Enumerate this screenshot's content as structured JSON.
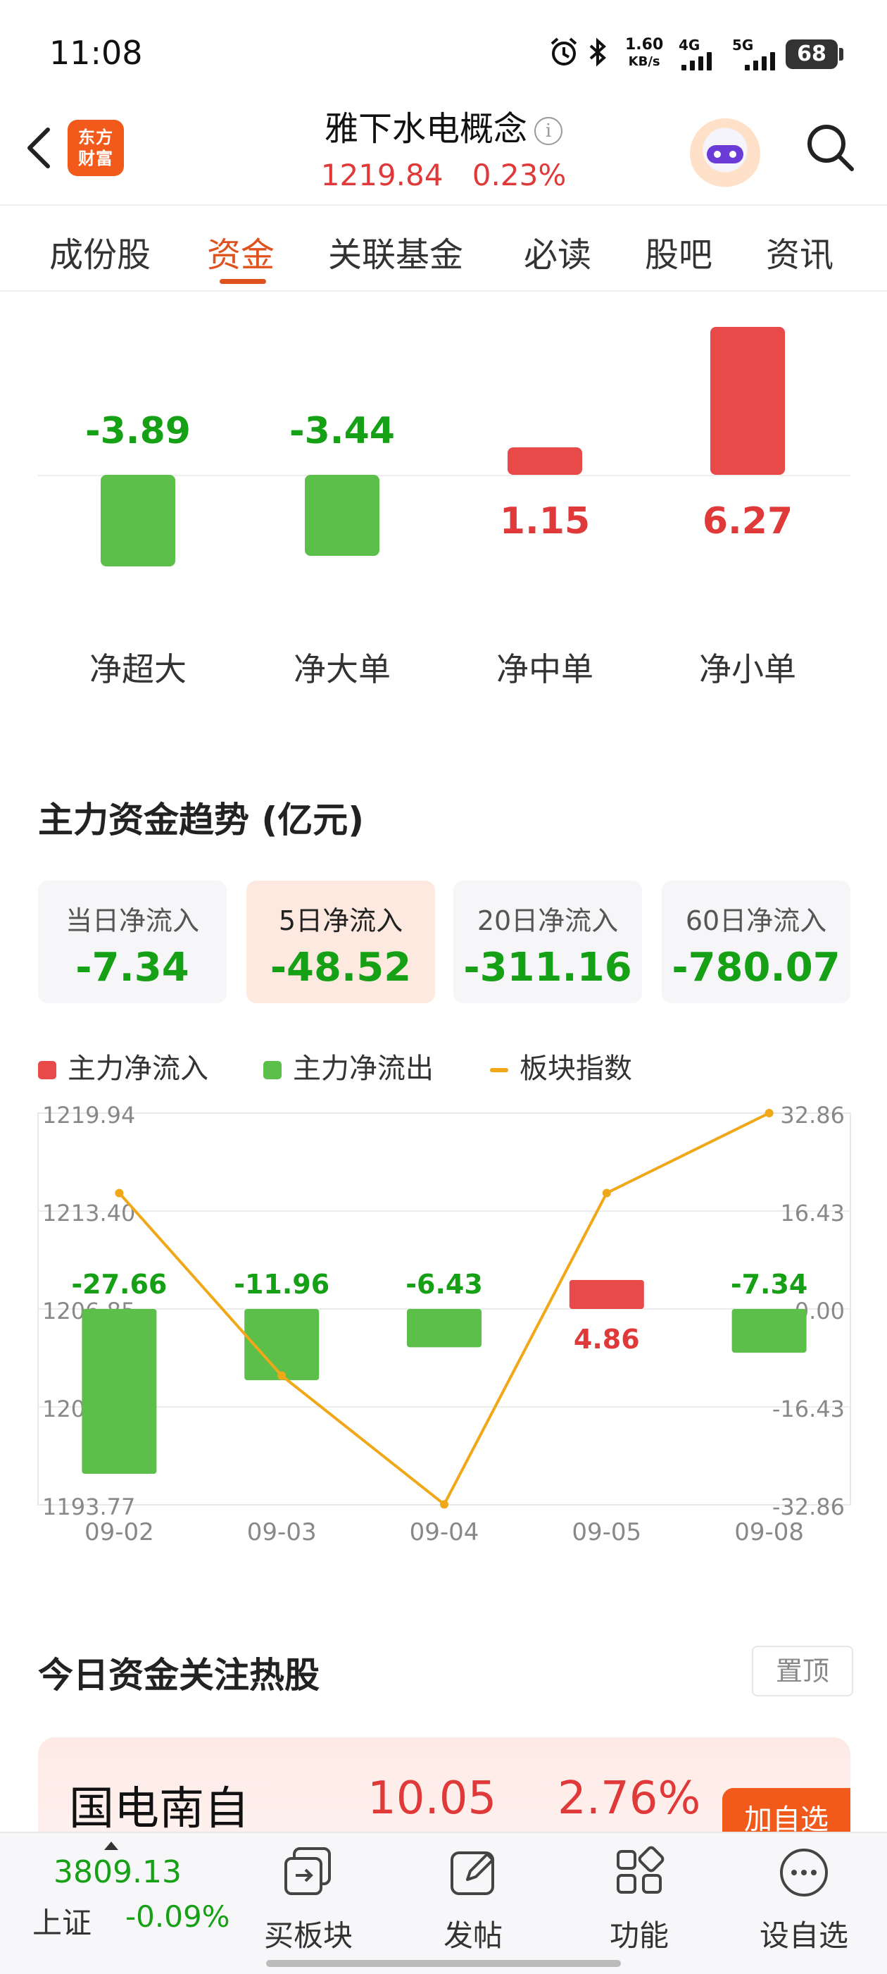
{
  "status_bar": {
    "time": "11:08",
    "net_speed_value": "1.60",
    "net_speed_unit": "KB/s",
    "signal_1_label": "4G",
    "signal_2_label": "5G",
    "battery": "68"
  },
  "header": {
    "logo_text_line1": "东方",
    "logo_text_line2": "财富",
    "title": "雅下水电概念",
    "info_icon": "i",
    "index_value": "1219.84",
    "index_change": "0.23%"
  },
  "tabs": [
    {
      "label": "成份股"
    },
    {
      "label": "资金"
    },
    {
      "label": "关联基金"
    },
    {
      "label": "必读"
    },
    {
      "label": "股吧"
    },
    {
      "label": "资讯"
    }
  ],
  "breakdown": {
    "colors": {
      "positive": "#e84a4a",
      "negative": "#5cbf4a"
    },
    "items": [
      {
        "label": "净超大",
        "value_text": "-3.89",
        "value": -3.89
      },
      {
        "label": "净大单",
        "value_text": "-3.44",
        "value": -3.44
      },
      {
        "label": "净中单",
        "value_text": "1.15",
        "value": 1.15
      },
      {
        "label": "净小单",
        "value_text": "6.27",
        "value": 6.27
      }
    ]
  },
  "trend_section": {
    "title": "主力资金趋势 (亿元)",
    "cards": [
      {
        "label": "当日净流入",
        "value": "-7.34"
      },
      {
        "label": "5日净流入",
        "value": "-48.52"
      },
      {
        "label": "20日净流入",
        "value": "-311.16"
      },
      {
        "label": "60日净流入",
        "value": "-780.07"
      }
    ],
    "legend": [
      {
        "label": "主力净流入",
        "color": "#e84a4a"
      },
      {
        "label": "主力净流出",
        "color": "#5cbf4a"
      },
      {
        "label": "板块指数",
        "color": "#f0a818"
      }
    ]
  },
  "chart_data": {
    "type": "bar",
    "categories": [
      "09-02",
      "09-03",
      "09-04",
      "09-05",
      "09-08"
    ],
    "series": [
      {
        "name": "主力净流入",
        "values": [
          -27.66,
          -11.96,
          -6.43,
          4.86,
          -7.34
        ],
        "labels": [
          "-27.66",
          "-11.96",
          "-6.43",
          "4.86",
          "-7.34"
        ]
      },
      {
        "name": "板块指数",
        "values": [
          1214.6,
          1202.4,
          1193.8,
          1214.6,
          1219.94
        ]
      }
    ],
    "left_axis": {
      "ticks": [
        "1219.94",
        "1213.40",
        "1206.85",
        "1200.31",
        "1193.77"
      ],
      "range": [
        1193.77,
        1219.94
      ]
    },
    "right_axis": {
      "ticks": [
        "32.86",
        "16.43",
        "0.00",
        "-16.43",
        "-32.86"
      ],
      "range": [
        -32.86,
        32.86
      ]
    },
    "grid": true
  },
  "hot_stocks": {
    "title": "今日资金关注热股",
    "pin_label": "置顶",
    "items": [
      {
        "name": "国电南自",
        "price": "10.05",
        "change": "2.76%",
        "action": "加自选"
      }
    ]
  },
  "bottom_bar": {
    "index_value": "3809.13",
    "index_name": "上证",
    "index_change": "-0.09%",
    "nav": [
      {
        "label": "买板块",
        "icon": "buy-sector-icon"
      },
      {
        "label": "发帖",
        "icon": "edit-icon"
      },
      {
        "label": "功能",
        "icon": "grid-icon"
      },
      {
        "label": "设自选",
        "icon": "more-icon"
      }
    ]
  }
}
